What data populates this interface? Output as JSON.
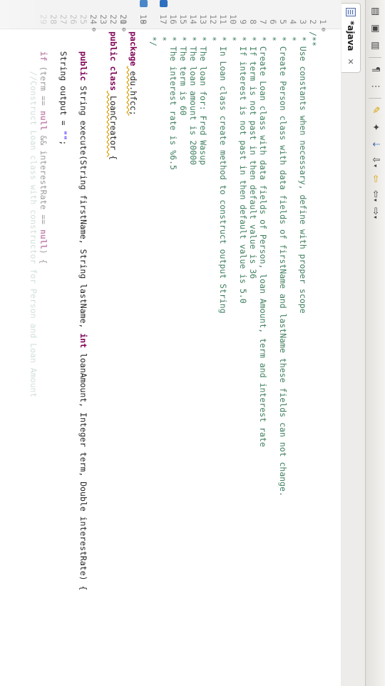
{
  "editor_tab": {
    "title": "*ajava"
  },
  "lines": [
    {
      "n": "1",
      "text": "/**"
    },
    {
      "n": "2",
      "text": " * Use constants when necessary, define with proper scope"
    },
    {
      "n": "3",
      "text": " *"
    },
    {
      "n": "4",
      "text": " * Create Person class with data fields of firstName and lastName these fields can not change."
    },
    {
      "n": "5",
      "text": " *"
    },
    {
      "n": "6",
      "text": " * Create Loan class with data fields of Person, loan Amount, term and interest rate"
    },
    {
      "n": "7",
      "text": " * If term is not past in then default value is 36"
    },
    {
      "n": "8",
      "text": " * If interest is not past in then default value is 5.0"
    },
    {
      "n": "9",
      "text": " *"
    },
    {
      "n": "10",
      "text": " * In Loan class create method to construct output String"
    },
    {
      "n": "11",
      "text": " *"
    },
    {
      "n": "12",
      "text": " * The loan for: Fred Wasup"
    },
    {
      "n": "13",
      "text": " * The loan amount is 20000"
    },
    {
      "n": "14",
      "text": " * The term is 60"
    },
    {
      "n": "15",
      "text": " * The interest rate is %6.5"
    },
    {
      "n": "16",
      "text": " *"
    },
    {
      "n": "17",
      "text": " */"
    },
    {
      "n": "18",
      "kw": "package",
      "rest": " edu.hfcc;"
    },
    {
      "n": "19",
      "text": ""
    },
    {
      "n": "20",
      "kw": "public class",
      "rest": " LoanCreator {"
    },
    {
      "n": "21",
      "text": ""
    },
    {
      "n": "22",
      "text": ""
    },
    {
      "n": "23",
      "text": ""
    },
    {
      "n": "24",
      "kw": "public",
      "mid1": " String execute(String firstName, String lastName, ",
      "kw2": "int",
      "mid2": " loanAmount, Integer term, Double interestRate) {"
    },
    {
      "n": "25",
      "text": ""
    },
    {
      "n": "26",
      "pre": "    String output = ",
      "str": "\"\"",
      "post": ";"
    },
    {
      "n": "27",
      "text": ""
    },
    {
      "n": "28",
      "pre": "    ",
      "kw": "if",
      "mid1": " (term == ",
      "kw2": "null",
      "mid2": " && interestRate == ",
      "kw3": "null",
      "post": ") {"
    },
    {
      "n": "29",
      "text": "        //Construct Loan class with constructor for Person and Loan Amount"
    }
  ]
}
